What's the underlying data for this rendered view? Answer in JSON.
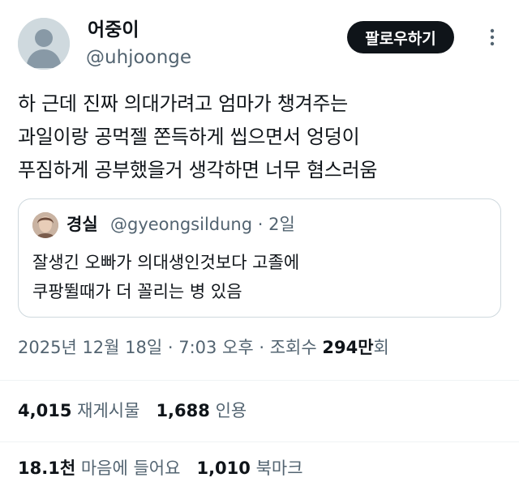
{
  "author": {
    "display_name": "어중이",
    "handle": "@uhjoonge"
  },
  "follow_button": {
    "label": "팔로우하기"
  },
  "more_icon": "vertical-dots-icon",
  "tweet": {
    "lines": [
      "하 근데 진짜 의대가려고 엄마가 챙겨주는",
      "과일이랑 공먹젤 쫀득하게 씹으면서 엉덩이",
      "푸짐하게 공부했을거 생각하면 너무 혐스러움"
    ]
  },
  "quote": {
    "display_name": "경실",
    "handle_time": "@gyeongsildung · 2일",
    "lines": [
      "잘생긴 오빠가 의대생인것보다 고졸에",
      "쿠팡뛸때가 더 꼴리는 병 있음"
    ]
  },
  "meta": {
    "date_time": "2025년 12월 18일 · 7:03 오후 · 조회수",
    "views_count": "294만",
    "views_suffix": "회"
  },
  "stats": {
    "retweets_count": "4,015",
    "retweets_label": "재게시물",
    "quotes_count": "1,688",
    "quotes_label": "인용",
    "likes_count": "18.1천",
    "likes_label": "마음에 들어요",
    "bookmarks_count": "1,010",
    "bookmarks_label": "북마크"
  },
  "colors": {
    "text": "#0f1419",
    "secondary": "#536471",
    "border": "#cfd9de",
    "divider": "#eff3f4",
    "button_bg": "#0f1419"
  }
}
